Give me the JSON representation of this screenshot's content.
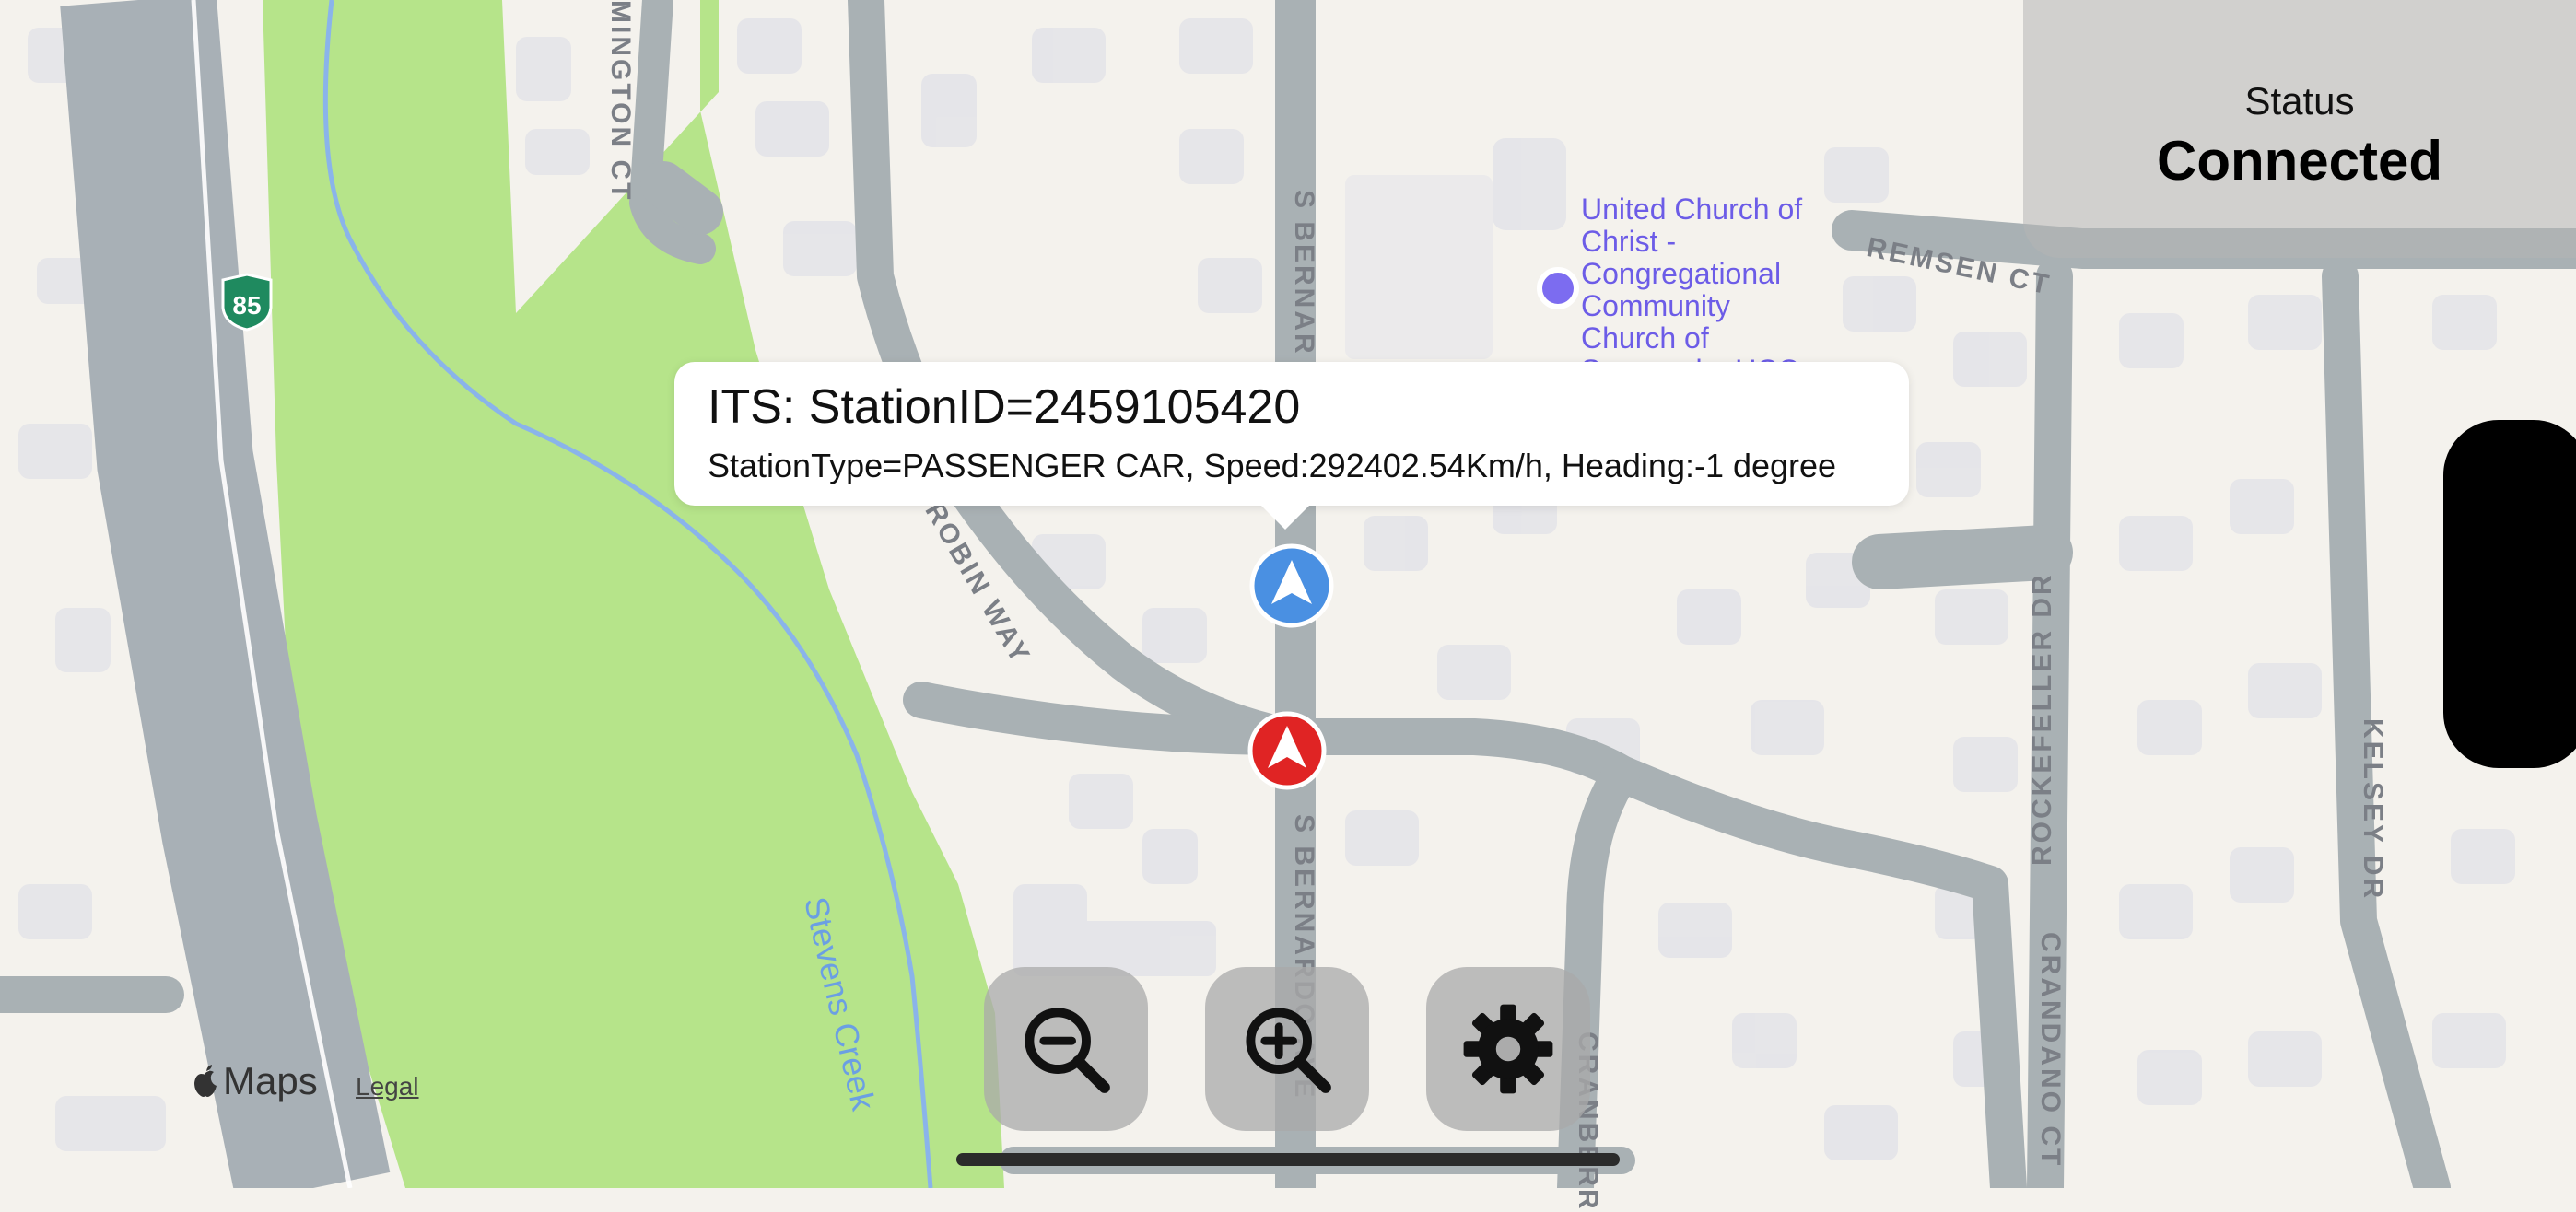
{
  "status": {
    "label": "Status",
    "value": "Connected"
  },
  "callout": {
    "title": "ITS: StationID=2459105420",
    "subtitle": "StationType=PASSENGER CAR, Speed:292402.54Km/h, Heading:-1 degree"
  },
  "map": {
    "streets": {
      "remington": "MINGTON CT",
      "bernardo_upper": "S BERNAR",
      "bernardo_lower": "S BERNARDO AVE",
      "robin": "ROBIN WAY",
      "remsen": "REMSEN CT",
      "rockefeller": "ROCKEFELLER DR",
      "crandano": "CRANDANO CT",
      "kelsey": "KELSEY DR",
      "cranberry": "CRANBERR"
    },
    "creek": "Stevens Creek",
    "highway": "85",
    "poi": "United Church of Christ - Congregational Community Church of Sunnyvale, UCC",
    "markers": [
      {
        "name": "station-marker-blue",
        "color": "#4a90e2"
      },
      {
        "name": "station-marker-red",
        "color": "#e02424"
      }
    ]
  },
  "controls": {
    "zoom_out_icon": "zoom-out-icon",
    "zoom_in_icon": "zoom-in-icon",
    "settings_icon": "gear-icon"
  },
  "attribution": {
    "maps": "Maps",
    "legal": "Legal"
  }
}
